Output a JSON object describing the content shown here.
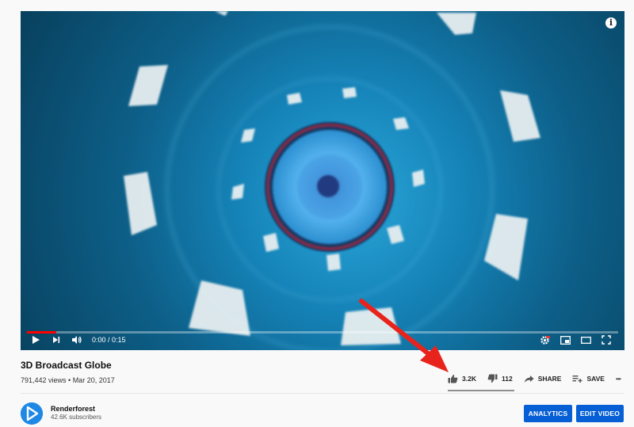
{
  "video": {
    "current_time": "0:00",
    "duration": "0:15",
    "time_display": "0:00 / 0:15",
    "progress": 0.05,
    "info_label": "i"
  },
  "details": {
    "title": "3D Broadcast Globe",
    "meta": "791,442 views • Mar 20, 2017"
  },
  "actions": {
    "likes": "3.2K",
    "dislikes": "112",
    "share": "SHARE",
    "save": "SAVE",
    "more": "•••"
  },
  "channel": {
    "name": "Renderforest",
    "subscribers": "42.6K subscribers"
  },
  "buttons": {
    "analytics": "ANALYTICS",
    "edit_video": "EDIT VIDEO"
  },
  "colors": {
    "progress": "#ff0000",
    "primary_button": "#065fd4",
    "annotation_arrow": "#e8231c",
    "avatar": "#1e88e5"
  },
  "icons": [
    "play-icon",
    "next-icon",
    "volume-icon",
    "settings-icon",
    "miniplayer-icon",
    "theater-icon",
    "fullscreen-icon",
    "thumbs-up-icon",
    "thumbs-down-icon",
    "share-icon",
    "save-playlist-icon",
    "more-icon",
    "info-icon"
  ]
}
